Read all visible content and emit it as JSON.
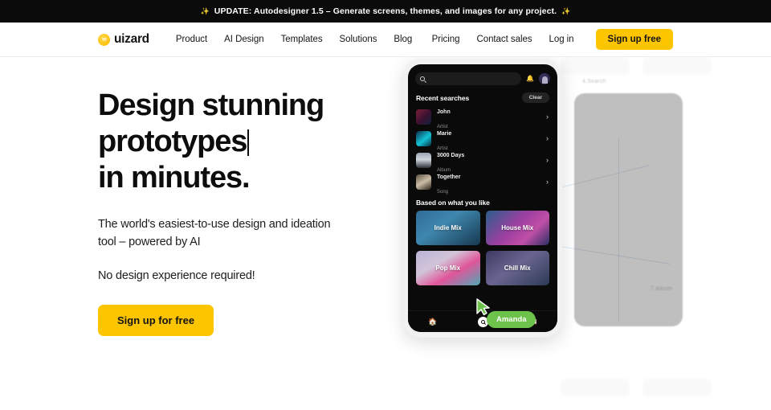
{
  "banner": {
    "sparkle_left": "sparkle-icon",
    "text": "UPDATE: Autodesigner 1.5 – Generate screens, themes, and images for any project.",
    "sparkle_right": "sparkle-icon",
    "background": "#0b0b0b"
  },
  "header": {
    "logo_text": "uizard",
    "nav_left": [
      {
        "label": "Product"
      },
      {
        "label": "AI Design"
      },
      {
        "label": "Templates"
      },
      {
        "label": "Solutions"
      },
      {
        "label": "Blog"
      }
    ],
    "nav_right": [
      {
        "label": "Pricing"
      },
      {
        "label": "Contact sales"
      },
      {
        "label": "Log in"
      }
    ],
    "cta_label": "Sign up free",
    "accent_color": "#fdc500"
  },
  "hero": {
    "headline_line1": "Design stunning",
    "headline_line2": "prototypes",
    "headline_line3": "in minutes.",
    "subtitle": "The world's easiest-to-use design and ideation tool – powered by AI",
    "subtitle2": "No design experience required!",
    "cta_label": "Sign up for free"
  },
  "phone": {
    "search_placeholder": "",
    "section_recent": "Recent searches",
    "clear_label": "Clear",
    "recent_items": [
      {
        "title": "John",
        "subtitle": "Artist"
      },
      {
        "title": "Marie",
        "subtitle": "Artist"
      },
      {
        "title": "3000 Days",
        "subtitle": "Album"
      },
      {
        "title": "Together",
        "subtitle": "Song"
      }
    ],
    "section_based": "Based on what you like",
    "mixes": [
      {
        "label": "Indie Mix"
      },
      {
        "label": "House Mix"
      },
      {
        "label": "Pop Mix"
      },
      {
        "label": "Chill Mix"
      }
    ],
    "tabs": [
      {
        "name": "home"
      },
      {
        "name": "search"
      },
      {
        "name": "library"
      }
    ]
  },
  "canvas": {
    "ghost_label_search": "4.Search",
    "ghost_label_album": "7.Album"
  },
  "cursor": {
    "name": "Amanda",
    "color": "#6cc24a"
  }
}
